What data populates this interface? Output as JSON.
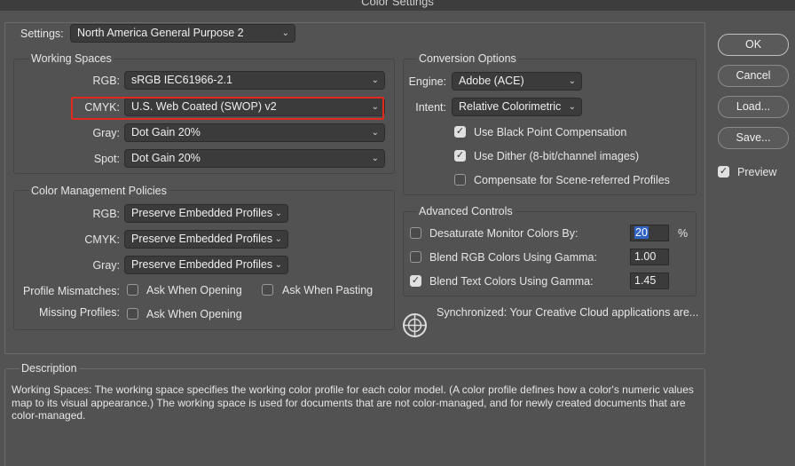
{
  "window": {
    "title": "Color Settings"
  },
  "settings": {
    "label": "Settings:",
    "value": "North America General Purpose 2"
  },
  "working_spaces": {
    "title": "Working Spaces",
    "rgb": {
      "label": "RGB:",
      "value": "sRGB IEC61966-2.1"
    },
    "cmyk": {
      "label": "CMYK:",
      "value": "U.S. Web Coated (SWOP) v2"
    },
    "gray": {
      "label": "Gray:",
      "value": "Dot Gain 20%"
    },
    "spot": {
      "label": "Spot:",
      "value": "Dot Gain 20%"
    }
  },
  "policies": {
    "title": "Color Management Policies",
    "rgb": {
      "label": "RGB:",
      "value": "Preserve Embedded Profiles"
    },
    "cmyk": {
      "label": "CMYK:",
      "value": "Preserve Embedded Profiles"
    },
    "gray": {
      "label": "Gray:",
      "value": "Preserve Embedded Profiles"
    },
    "profile_mismatches": {
      "label": "Profile Mismatches:",
      "ask_opening": "Ask When Opening",
      "ask_pasting": "Ask When Pasting"
    },
    "missing_profiles": {
      "label": "Missing Profiles:",
      "ask_opening": "Ask When Opening"
    }
  },
  "conversion": {
    "title": "Conversion Options",
    "engine": {
      "label": "Engine:",
      "value": "Adobe (ACE)"
    },
    "intent": {
      "label": "Intent:",
      "value": "Relative Colorimetric"
    },
    "black_point": "Use Black Point Compensation",
    "dither": "Use Dither (8-bit/channel images)",
    "scene": "Compensate for Scene-referred Profiles"
  },
  "advanced": {
    "title": "Advanced Controls",
    "desaturate": {
      "label": "Desaturate Monitor Colors By:",
      "value": "20",
      "unit": "%"
    },
    "blend_rgb": {
      "label": "Blend RGB Colors Using Gamma:",
      "value": "1.00"
    },
    "blend_text": {
      "label": "Blend Text Colors Using Gamma:",
      "value": "1.45"
    }
  },
  "sync": {
    "text": "Synchronized: Your Creative Cloud applications are..."
  },
  "buttons": {
    "ok": "OK",
    "cancel": "Cancel",
    "load": "Load...",
    "save": "Save...",
    "preview": "Preview"
  },
  "description": {
    "title": "Description",
    "text": "Working Spaces:  The working space specifies the working color profile for each color model.  (A color profile defines how a color's numeric values map to its visual appearance.)  The working space is used for documents that are not color-managed, and for newly created documents that are color-managed."
  },
  "icons": {
    "chevron": "chevron-updown-icon",
    "check": "checkmark-icon",
    "globe": "globe-sync-icon"
  },
  "colors": {
    "highlight": "#e1291c",
    "selection": "#2f63c5"
  }
}
